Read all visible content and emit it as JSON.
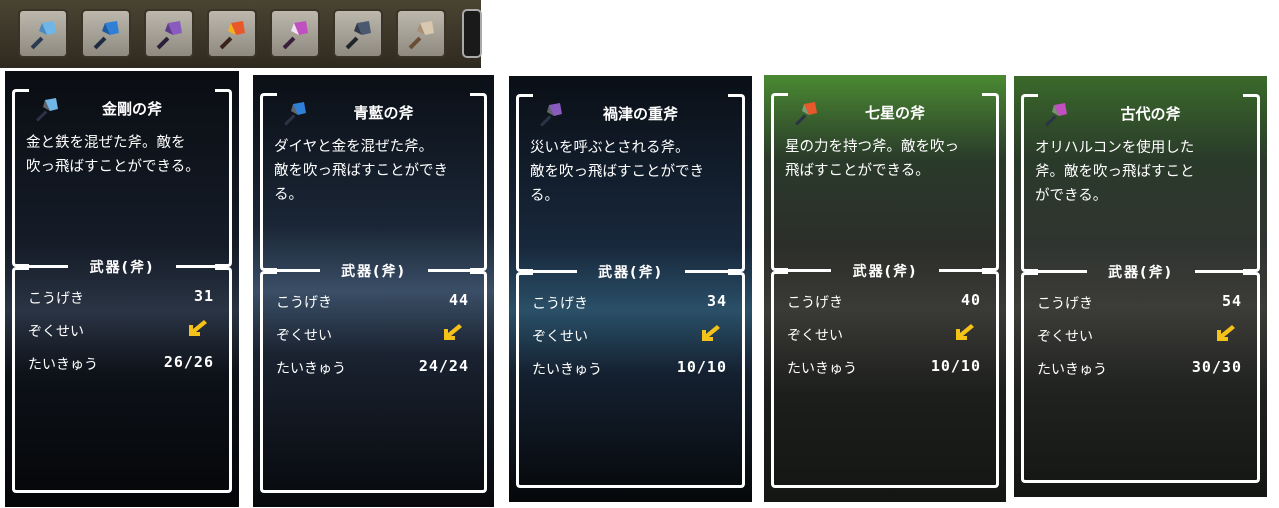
{
  "hotbar": {
    "slots": [
      {
        "icon": "diamond-axe-icon",
        "color": "#6fb6e6"
      },
      {
        "icon": "sapphire-axe-icon",
        "color": "#2f7fd6"
      },
      {
        "icon": "cursed-axe-icon",
        "color": "#8a5bbf"
      },
      {
        "icon": "seven-star-axe-icon",
        "color": "#e8582a"
      },
      {
        "icon": "ancient-axe-icon",
        "color": "#c04fc0"
      },
      {
        "icon": "steel-axe-icon",
        "color": "#4a5870"
      },
      {
        "icon": "stone-axe-icon",
        "color": "#c8b29a"
      }
    ]
  },
  "panels": [
    {
      "name": "金剛の斧",
      "description": [
        "金と鉄を混ぜた斧。敵を",
        "吹っ飛ばすことができる。"
      ],
      "category": "武器(斧)",
      "stats": {
        "attack_label": "こうげき",
        "attack": "31",
        "element_label": "ぞくせい",
        "durability_label": "たいきゅう",
        "durability": "26/26"
      },
      "icon_color": "#6fb6e6"
    },
    {
      "name": "青藍の斧",
      "description": [
        "ダイヤと金を混ぜた斧。",
        "敵を吹っ飛ばすことができ",
        "る。"
      ],
      "category": "武器(斧)",
      "stats": {
        "attack_label": "こうげき",
        "attack": "44",
        "element_label": "ぞくせい",
        "durability_label": "たいきゅう",
        "durability": "24/24"
      },
      "icon_color": "#2f7fd6"
    },
    {
      "name": "禍津の重斧",
      "description": [
        "災いを呼ぶとされる斧。",
        "敵を吹っ飛ばすことができ",
        "る。"
      ],
      "category": "武器(斧)",
      "stats": {
        "attack_label": "こうげき",
        "attack": "34",
        "element_label": "ぞくせい",
        "durability_label": "たいきゅう",
        "durability": "10/10"
      },
      "icon_color": "#8a5bbf"
    },
    {
      "name": "七星の斧",
      "description": [
        "星の力を持つ斧。敵を吹っ",
        "飛ばすことができる。"
      ],
      "category": "武器(斧)",
      "stats": {
        "attack_label": "こうげき",
        "attack": "40",
        "element_label": "ぞくせい",
        "durability_label": "たいきゅう",
        "durability": "10/10"
      },
      "icon_color": "#e8582a"
    },
    {
      "name": "古代の斧",
      "description": [
        "オリハルコンを使用した",
        "斧。敵を吹っ飛ばすこと",
        "ができる。"
      ],
      "category": "武器(斧)",
      "stats": {
        "attack_label": "こうげき",
        "attack": "54",
        "element_label": "ぞくせい",
        "durability_label": "たいきゅう",
        "durability": "30/30"
      },
      "icon_color": "#c04fc0"
    }
  ],
  "colors": {
    "element_arrow": "#f5c21a"
  }
}
